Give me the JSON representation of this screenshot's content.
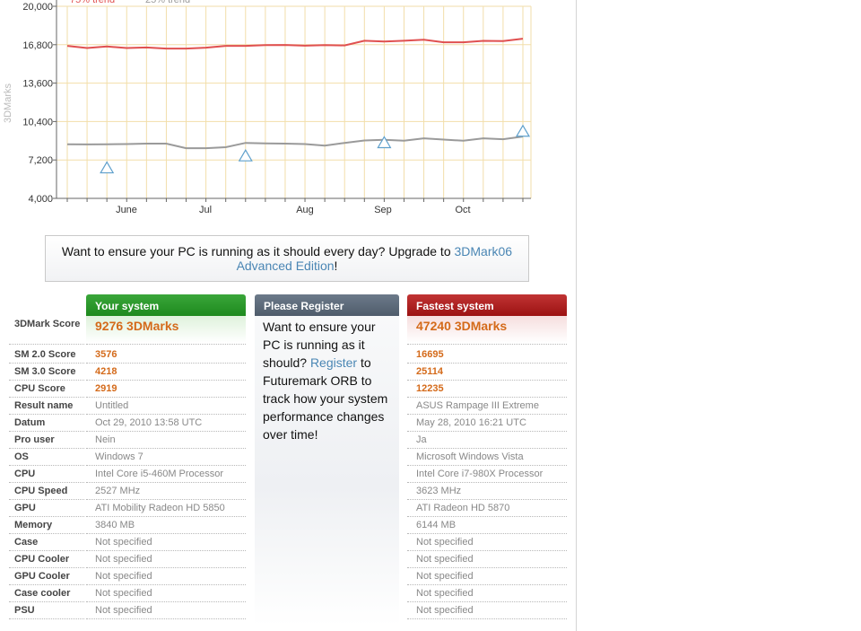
{
  "chart_data": {
    "type": "line",
    "ylabel": "3DMarks",
    "legend": [
      "75% trend",
      "25% trend"
    ],
    "yticks": [
      "20,000",
      "16,800",
      "13,600",
      "10,400",
      "7,200",
      "4,000"
    ],
    "xticks": [
      "June",
      "Jul",
      "Aug",
      "Sep",
      "Oct"
    ],
    "ylim": [
      4000,
      20000
    ],
    "grid": true,
    "colors": {
      "trend75": "#e05050",
      "trend25": "#9a9a9a",
      "marker": "#5fa0cc",
      "grid": "#f2deaa"
    },
    "series": [
      {
        "name": "75% trend",
        "values": [
          16700,
          16520,
          16650,
          16520,
          16570,
          16480,
          16480,
          16550,
          16700,
          16700,
          16770,
          16780,
          16720,
          16760,
          16740,
          17130,
          17060,
          17130,
          17220,
          17000,
          17000,
          17120,
          17100,
          17300
        ]
      },
      {
        "name": "25% trend",
        "values": [
          8500,
          8490,
          8510,
          8520,
          8560,
          8560,
          8180,
          8180,
          8260,
          8620,
          8580,
          8560,
          8520,
          8400,
          8620,
          8820,
          8880,
          8800,
          9000,
          8900,
          8800,
          9000,
          8930,
          9150
        ]
      }
    ],
    "markers": [
      6500,
      7500,
      8600,
      9550
    ]
  },
  "banner": {
    "text": "Want to ensure your PC is running as it should every day? Upgrade to ",
    "link": "3DMark06 Advanced Edition",
    "suffix": "!"
  },
  "columns": {
    "your": "Your system",
    "register": "Please Register",
    "fastest": "Fastest system"
  },
  "register": {
    "before": "Want to ensure your PC is running as it should? ",
    "link": "Register",
    "after": " to Futuremark ORB to track how your system performance changes over time!"
  },
  "rows": [
    {
      "label": "3DMark Score",
      "your": "9276 3DMarks",
      "fast": "47240 3DMarks"
    },
    {
      "label": "SM 2.0 Score",
      "your": "3576",
      "fast": "16695"
    },
    {
      "label": "SM 3.0 Score",
      "your": "4218",
      "fast": "25114"
    },
    {
      "label": "CPU Score",
      "your": "2919",
      "fast": "12235"
    },
    {
      "label": "Result name",
      "your": "Untitled",
      "fast": "ASUS Rampage III Extreme"
    },
    {
      "label": "Datum",
      "your": "Oct 29, 2010 13:58 UTC",
      "fast": "May 28, 2010 16:21 UTC"
    },
    {
      "label": "Pro user",
      "your": "Nein",
      "fast": "Ja"
    },
    {
      "label": "OS",
      "your": "Windows 7",
      "fast": "Microsoft Windows Vista"
    },
    {
      "label": "CPU",
      "your": "Intel Core i5-460M Processor",
      "fast": "Intel Core i7-980X Processor"
    },
    {
      "label": "CPU Speed",
      "your": "2527 MHz",
      "fast": "3623 MHz"
    },
    {
      "label": "GPU",
      "your": "ATI Mobility Radeon HD 5850",
      "fast": "ATI Radeon HD 5870"
    },
    {
      "label": "Memory",
      "your": "3840 MB",
      "fast": "6144 MB"
    },
    {
      "label": "Case",
      "your": "Not specified",
      "fast": "Not specified"
    },
    {
      "label": "CPU Cooler",
      "your": "Not specified",
      "fast": "Not specified"
    },
    {
      "label": "GPU Cooler",
      "your": "Not specified",
      "fast": "Not specified"
    },
    {
      "label": "Case cooler",
      "your": "Not specified",
      "fast": "Not specified"
    },
    {
      "label": "PSU",
      "your": "Not specified",
      "fast": "Not specified"
    }
  ]
}
